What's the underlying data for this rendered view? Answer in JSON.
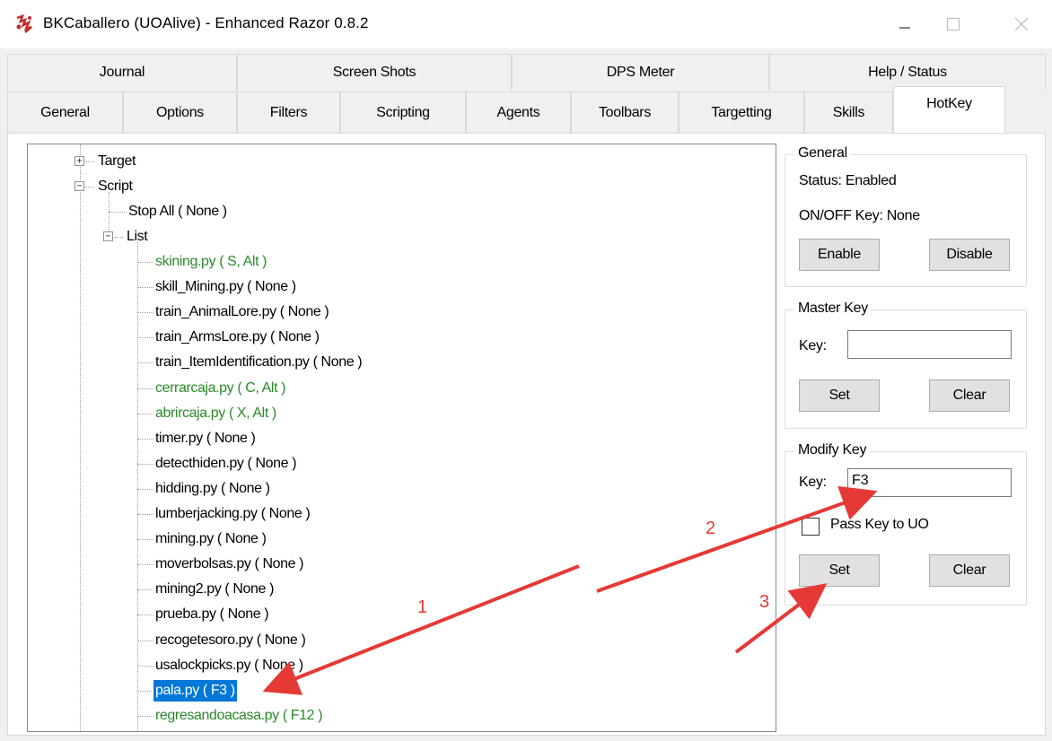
{
  "window": {
    "title": "BKCaballero (UOAlive) - Enhanced Razor 0.8.2",
    "minimize": "—",
    "maximize": "☐",
    "close": "✕"
  },
  "tabs": {
    "row1": [
      "Journal",
      "Screen Shots",
      "DPS Meter",
      "Help / Status"
    ],
    "row2": [
      "General",
      "Options",
      "Filters",
      "Scripting",
      "Agents",
      "Toolbars",
      "Targetting",
      "Skills",
      "HotKey"
    ],
    "active": "HotKey"
  },
  "tree": {
    "target": "Target",
    "script": "Script",
    "stop_all": "Stop All ( None )",
    "list": "List",
    "items": [
      {
        "label": "skining.py ( S, Alt )",
        "state": "assigned"
      },
      {
        "label": "skill_Mining.py ( None )",
        "state": "normal"
      },
      {
        "label": "train_AnimalLore.py ( None )",
        "state": "normal"
      },
      {
        "label": "train_ArmsLore.py ( None )",
        "state": "normal"
      },
      {
        "label": "train_ItemIdentification.py ( None )",
        "state": "normal"
      },
      {
        "label": "cerrarcaja.py ( C, Alt )",
        "state": "assigned"
      },
      {
        "label": "abrircaja.py ( X, Alt )",
        "state": "assigned"
      },
      {
        "label": "timer.py ( None )",
        "state": "normal"
      },
      {
        "label": "detecthiden.py ( None )",
        "state": "normal"
      },
      {
        "label": "hidding.py ( None )",
        "state": "normal"
      },
      {
        "label": "lumberjacking.py ( None )",
        "state": "normal"
      },
      {
        "label": "mining.py ( None )",
        "state": "normal"
      },
      {
        "label": "moverbolsas.py ( None )",
        "state": "normal"
      },
      {
        "label": "mining2.py ( None )",
        "state": "normal"
      },
      {
        "label": "prueba.py ( None )",
        "state": "normal"
      },
      {
        "label": "recogetesoro.py ( None )",
        "state": "normal"
      },
      {
        "label": "usalockpicks.py ( None )",
        "state": "normal"
      },
      {
        "label": "pala.py ( F3 )",
        "state": "selected"
      },
      {
        "label": "regresandoacasa.py ( F12 )",
        "state": "assigned"
      }
    ]
  },
  "general": {
    "title": "General",
    "status": "Status: Enabled",
    "onoff": "ON/OFF Key: None",
    "enable": "Enable",
    "disable": "Disable"
  },
  "master": {
    "title": "Master Key",
    "key_label": "Key:",
    "key_value": "",
    "set": "Set",
    "clear": "Clear"
  },
  "modify": {
    "title": "Modify Key",
    "key_label": "Key:",
    "key_value": "F3",
    "pass_key": "Pass Key to UO",
    "set": "Set",
    "clear": "Clear"
  },
  "annotations": {
    "label1": "1",
    "label2": "2",
    "label3": "3",
    "color": "#e53935"
  },
  "colors": {
    "assigned": "#2a8a2a",
    "selection": "#0078d7",
    "scrollbar_thumb": "#cdcdcd"
  }
}
